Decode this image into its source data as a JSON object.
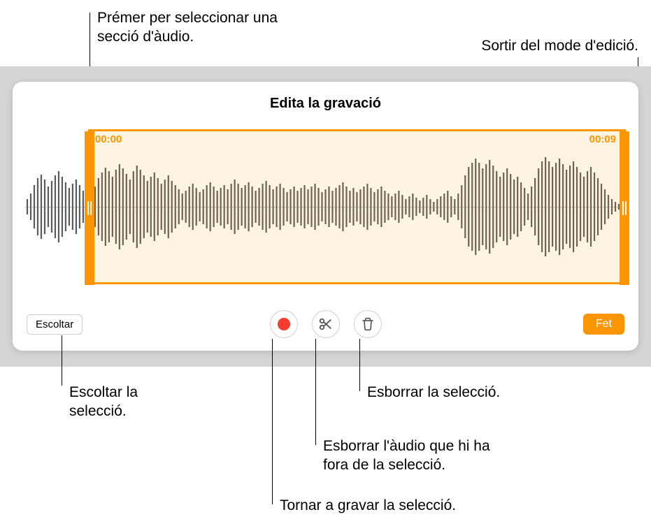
{
  "callouts": {
    "select_section": "Prémer per seleccionar una secció d'àudio.",
    "exit_mode": "Sortir del mode d'edició.",
    "listen_selection": "Escoltar la selecció.",
    "rerecord_selection": "Tornar a gravar la selecció.",
    "trim_outside": "Esborrar l'àudio que hi ha fora de la selecció.",
    "delete_selection": "Esborrar la selecció."
  },
  "panel": {
    "title": "Edita la gravació",
    "time_start": "00:00",
    "time_end": "00:09"
  },
  "toolbar": {
    "listen_label": "Escoltar",
    "done_label": "Fet"
  }
}
